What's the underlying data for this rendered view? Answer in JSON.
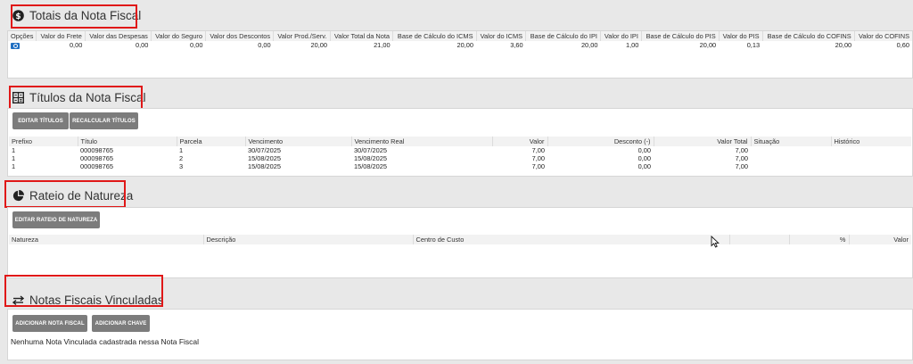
{
  "totais": {
    "title": "Totais da Nota Fiscal",
    "headers": [
      "Opções",
      "Valor do Frete",
      "Valor das Despesas",
      "Valor do Seguro",
      "Valor dos Descontos",
      "Valor Prod./Serv.",
      "Valor Total da Nota",
      "Base de Cálculo do ICMS",
      "Valor do ICMS",
      "Base de Cálculo do IPI",
      "Valor do IPI",
      "Base de Cálculo do PIS",
      "Valor do PIS",
      "Base de Cálculo do COFINS",
      "Valor do COFINS"
    ],
    "row": [
      "0,00",
      "0,00",
      "0,00",
      "0,00",
      "20,00",
      "21,00",
      "20,00",
      "3,60",
      "20,00",
      "1,00",
      "20,00",
      "0,13",
      "20,00",
      "0,60"
    ]
  },
  "titulos": {
    "title": "Títulos da Nota Fiscal",
    "btn_editar": "EDITAR TÍTULOS",
    "btn_recalcular": "RECALCULAR TÍTULOS",
    "headers": [
      "Prefixo",
      "Título",
      "Parcela",
      "Vencimento",
      "Vencimento Real",
      "Valor",
      "Desconto (-)",
      "Valor Total",
      "Situação",
      "Histórico"
    ],
    "rows": [
      [
        "1",
        "000098765",
        "1",
        "30/07/2025",
        "30/07/2025",
        "7,00",
        "0,00",
        "7,00",
        "",
        ""
      ],
      [
        "1",
        "000098765",
        "2",
        "15/08/2025",
        "15/08/2025",
        "7,00",
        "0,00",
        "7,00",
        "",
        ""
      ],
      [
        "1",
        "000098765",
        "3",
        "15/08/2025",
        "15/08/2025",
        "7,00",
        "0,00",
        "7,00",
        "",
        ""
      ]
    ]
  },
  "rateio": {
    "title": "Rateio de Natureza",
    "btn_editar": "EDITAR RATEIO DE NATUREZA",
    "headers": [
      "Natureza",
      "Descrição",
      "Centro de Custo",
      "",
      "%",
      "Valor"
    ]
  },
  "notas": {
    "title": "Notas Fiscais Vinculadas",
    "btn_adicionar_nota": "ADICIONAR NOTA FISCAL",
    "btn_adicionar_chave": "ADICIONAR CHAVE",
    "empty_message": "Nenhuma Nota Vinculada cadastrada nessa Nota Fiscal"
  },
  "colors": {
    "highlight": "#e01818",
    "button": "#7c7c7c",
    "icon_blue": "#1f6fc2"
  }
}
